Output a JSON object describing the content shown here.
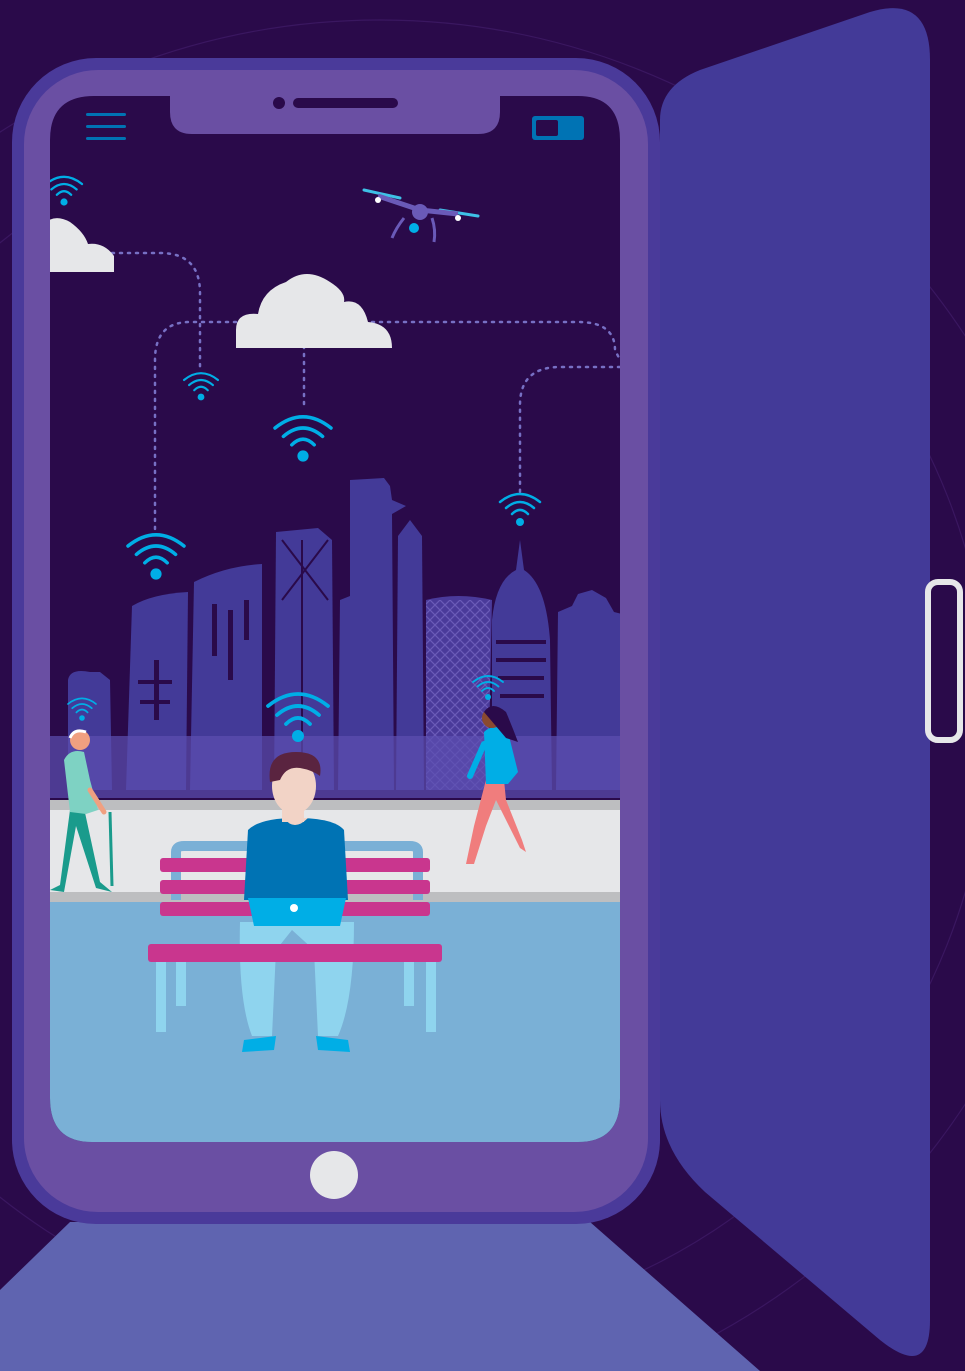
{
  "colors": {
    "background": "#2a0a4a",
    "phone_frame": "#6a4fa3",
    "phone_rim": "#4a3a9a",
    "door": "#433a98",
    "floor": "#5f64b0",
    "screen_sky": "#2a0a4a",
    "skyline": "#433a98",
    "wifi": "#00aee6",
    "bench": "#c9368e",
    "water": "#7ab0d6",
    "promenade": "#e6e7e9",
    "cloud": "#e6e7e9"
  },
  "icons": {
    "menu": "hamburger-menu-icon",
    "battery": "battery-icon",
    "home": "home-button-icon",
    "wifi": "wifi-icon",
    "cloud": "cloud-icon",
    "drone": "drone-icon"
  }
}
